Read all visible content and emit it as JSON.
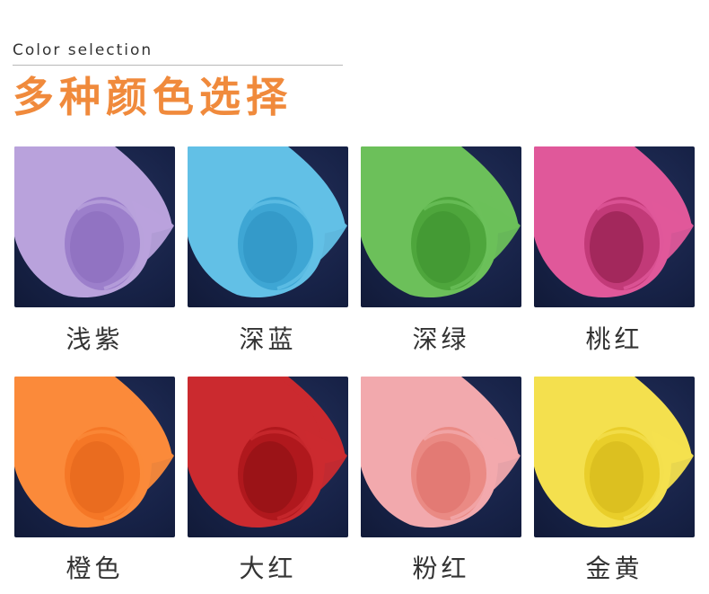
{
  "header": {
    "subtitle_en": "Color selection",
    "title_cn": "多种颜色选择",
    "title_color": "#f08a3c"
  },
  "swatches": [
    {
      "label": "浅紫",
      "color": "#b9a2dc",
      "inner": "#9c7fcb",
      "shade": "#8a6bbd"
    },
    {
      "label": "深蓝",
      "color": "#62c0e6",
      "inner": "#3ea6d4",
      "shade": "#2f93c2"
    },
    {
      "label": "深绿",
      "color": "#6cc05a",
      "inner": "#4ea63c",
      "shade": "#3e922e"
    },
    {
      "label": "桃红",
      "color": "#e0589a",
      "inner": "#c23a78",
      "shade": "#8e1c4a"
    },
    {
      "label": "橙色",
      "color": "#fb8a3a",
      "inner": "#f57726",
      "shade": "#e2651a"
    },
    {
      "label": "大红",
      "color": "#cb2a2f",
      "inner": "#b0181d",
      "shade": "#8d1014"
    },
    {
      "label": "粉红",
      "color": "#f2a9ad",
      "inner": "#ea8a84",
      "shade": "#dd6f69"
    },
    {
      "label": "金黄",
      "color": "#f4e04e",
      "inner": "#e9ce2a",
      "shade": "#d4b81a"
    }
  ]
}
